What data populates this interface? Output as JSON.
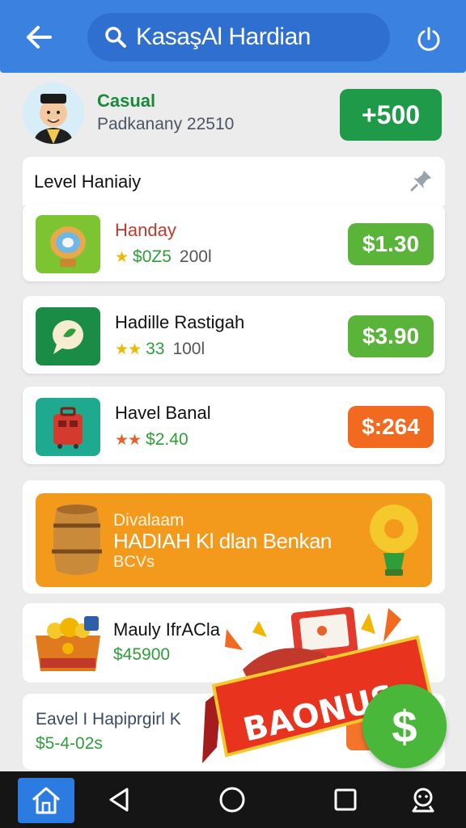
{
  "header": {
    "search_text": "KasaşAl Hardian"
  },
  "profile": {
    "name": "Casual",
    "subtitle": "Padkanany 22510",
    "bonus_button": "+500"
  },
  "level": {
    "title": "Level Haniaiy",
    "items": [
      {
        "name": "Handay",
        "stars": "★",
        "meta_value": "$0Z5",
        "meta_extra": "200l",
        "price": "$1.30",
        "name_color": "#c0392b",
        "price_color": "#5bb43a"
      },
      {
        "name": "Hadille Rastigah",
        "stars": "★★",
        "meta_value": "33",
        "meta_extra": "100l",
        "price": "$3.90",
        "name_color": "#111111",
        "price_color": "#5bb43a"
      },
      {
        "name": "Havel Banal",
        "stars": "★★",
        "meta_value": "$2.40",
        "meta_extra": "",
        "price": "$:264",
        "name_color": "#111111",
        "price_color": "#f26a20"
      }
    ]
  },
  "banner": {
    "line1": "Divalaam",
    "line2": "HADIAH Kl dlan Benkan",
    "line3": "BCVs"
  },
  "card_a": {
    "title": "Mauly IfrACla",
    "value": "$45900"
  },
  "card_b": {
    "title": "Eavel I Hapiprgirl K",
    "value": "$5-4-02s"
  },
  "overlay": {
    "ribbon_text": "BAONUS",
    "fab_symbol": "$"
  },
  "colors": {
    "header": "#3b82e0",
    "green": "#1e9a48",
    "orange": "#f39a1d",
    "nav": "#151515"
  }
}
